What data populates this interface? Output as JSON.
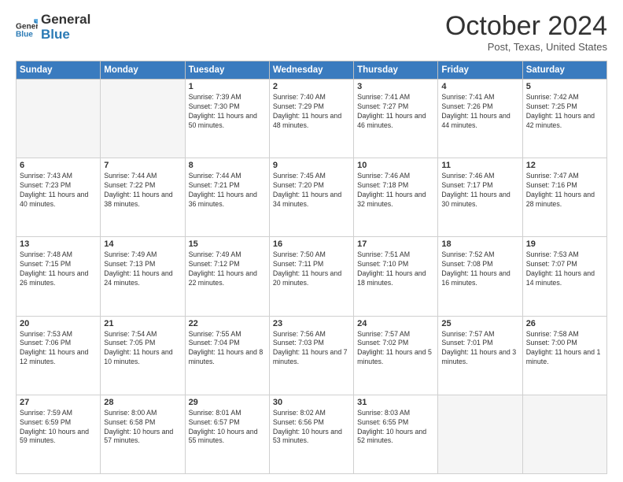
{
  "header": {
    "logo_general": "General",
    "logo_blue": "Blue",
    "month_title": "October 2024",
    "location": "Post, Texas, United States"
  },
  "days_of_week": [
    "Sunday",
    "Monday",
    "Tuesday",
    "Wednesday",
    "Thursday",
    "Friday",
    "Saturday"
  ],
  "weeks": [
    [
      {
        "day": "",
        "info": ""
      },
      {
        "day": "",
        "info": ""
      },
      {
        "day": "1",
        "info": "Sunrise: 7:39 AM\nSunset: 7:30 PM\nDaylight: 11 hours and 50 minutes."
      },
      {
        "day": "2",
        "info": "Sunrise: 7:40 AM\nSunset: 7:29 PM\nDaylight: 11 hours and 48 minutes."
      },
      {
        "day": "3",
        "info": "Sunrise: 7:41 AM\nSunset: 7:27 PM\nDaylight: 11 hours and 46 minutes."
      },
      {
        "day": "4",
        "info": "Sunrise: 7:41 AM\nSunset: 7:26 PM\nDaylight: 11 hours and 44 minutes."
      },
      {
        "day": "5",
        "info": "Sunrise: 7:42 AM\nSunset: 7:25 PM\nDaylight: 11 hours and 42 minutes."
      }
    ],
    [
      {
        "day": "6",
        "info": "Sunrise: 7:43 AM\nSunset: 7:23 PM\nDaylight: 11 hours and 40 minutes."
      },
      {
        "day": "7",
        "info": "Sunrise: 7:44 AM\nSunset: 7:22 PM\nDaylight: 11 hours and 38 minutes."
      },
      {
        "day": "8",
        "info": "Sunrise: 7:44 AM\nSunset: 7:21 PM\nDaylight: 11 hours and 36 minutes."
      },
      {
        "day": "9",
        "info": "Sunrise: 7:45 AM\nSunset: 7:20 PM\nDaylight: 11 hours and 34 minutes."
      },
      {
        "day": "10",
        "info": "Sunrise: 7:46 AM\nSunset: 7:18 PM\nDaylight: 11 hours and 32 minutes."
      },
      {
        "day": "11",
        "info": "Sunrise: 7:46 AM\nSunset: 7:17 PM\nDaylight: 11 hours and 30 minutes."
      },
      {
        "day": "12",
        "info": "Sunrise: 7:47 AM\nSunset: 7:16 PM\nDaylight: 11 hours and 28 minutes."
      }
    ],
    [
      {
        "day": "13",
        "info": "Sunrise: 7:48 AM\nSunset: 7:15 PM\nDaylight: 11 hours and 26 minutes."
      },
      {
        "day": "14",
        "info": "Sunrise: 7:49 AM\nSunset: 7:13 PM\nDaylight: 11 hours and 24 minutes."
      },
      {
        "day": "15",
        "info": "Sunrise: 7:49 AM\nSunset: 7:12 PM\nDaylight: 11 hours and 22 minutes."
      },
      {
        "day": "16",
        "info": "Sunrise: 7:50 AM\nSunset: 7:11 PM\nDaylight: 11 hours and 20 minutes."
      },
      {
        "day": "17",
        "info": "Sunrise: 7:51 AM\nSunset: 7:10 PM\nDaylight: 11 hours and 18 minutes."
      },
      {
        "day": "18",
        "info": "Sunrise: 7:52 AM\nSunset: 7:08 PM\nDaylight: 11 hours and 16 minutes."
      },
      {
        "day": "19",
        "info": "Sunrise: 7:53 AM\nSunset: 7:07 PM\nDaylight: 11 hours and 14 minutes."
      }
    ],
    [
      {
        "day": "20",
        "info": "Sunrise: 7:53 AM\nSunset: 7:06 PM\nDaylight: 11 hours and 12 minutes."
      },
      {
        "day": "21",
        "info": "Sunrise: 7:54 AM\nSunset: 7:05 PM\nDaylight: 11 hours and 10 minutes."
      },
      {
        "day": "22",
        "info": "Sunrise: 7:55 AM\nSunset: 7:04 PM\nDaylight: 11 hours and 8 minutes."
      },
      {
        "day": "23",
        "info": "Sunrise: 7:56 AM\nSunset: 7:03 PM\nDaylight: 11 hours and 7 minutes."
      },
      {
        "day": "24",
        "info": "Sunrise: 7:57 AM\nSunset: 7:02 PM\nDaylight: 11 hours and 5 minutes."
      },
      {
        "day": "25",
        "info": "Sunrise: 7:57 AM\nSunset: 7:01 PM\nDaylight: 11 hours and 3 minutes."
      },
      {
        "day": "26",
        "info": "Sunrise: 7:58 AM\nSunset: 7:00 PM\nDaylight: 11 hours and 1 minute."
      }
    ],
    [
      {
        "day": "27",
        "info": "Sunrise: 7:59 AM\nSunset: 6:59 PM\nDaylight: 10 hours and 59 minutes."
      },
      {
        "day": "28",
        "info": "Sunrise: 8:00 AM\nSunset: 6:58 PM\nDaylight: 10 hours and 57 minutes."
      },
      {
        "day": "29",
        "info": "Sunrise: 8:01 AM\nSunset: 6:57 PM\nDaylight: 10 hours and 55 minutes."
      },
      {
        "day": "30",
        "info": "Sunrise: 8:02 AM\nSunset: 6:56 PM\nDaylight: 10 hours and 53 minutes."
      },
      {
        "day": "31",
        "info": "Sunrise: 8:03 AM\nSunset: 6:55 PM\nDaylight: 10 hours and 52 minutes."
      },
      {
        "day": "",
        "info": ""
      },
      {
        "day": "",
        "info": ""
      }
    ]
  ]
}
